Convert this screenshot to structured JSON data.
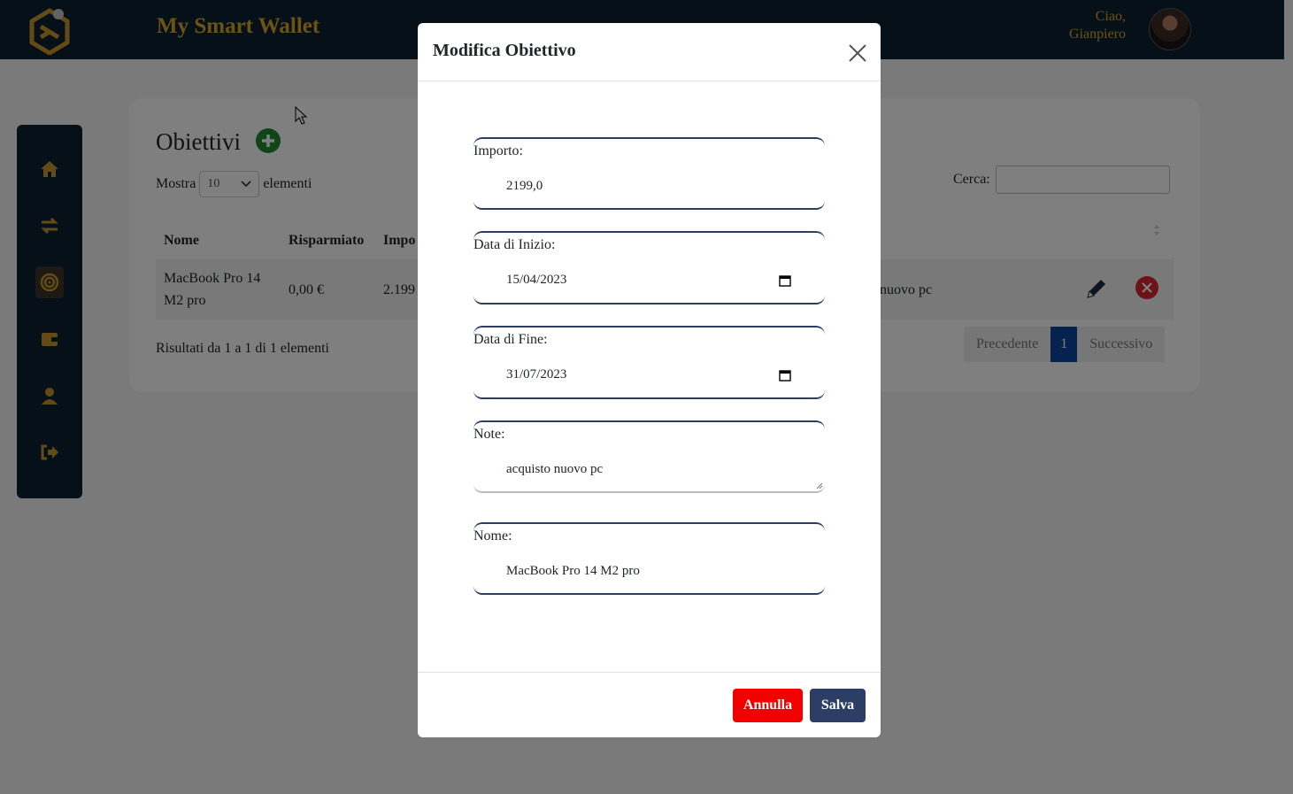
{
  "header": {
    "brand": "My Smart Wallet",
    "greeting_line1": "Ciao,",
    "greeting_line2": "Gianpiero"
  },
  "sidebar": {
    "items": [
      "home-icon",
      "transfer-icon",
      "target-icon",
      "wallet-icon",
      "user-icon",
      "logout-icon"
    ],
    "active": "target-icon"
  },
  "page": {
    "title": "Obiettivi",
    "show_label": "Mostra",
    "show_value": "10",
    "elements_label": "elementi",
    "search_label": "Cerca:",
    "columns": {
      "name": "Nome",
      "saved": "Risparmiato",
      "amount": "Impo"
    },
    "row": {
      "name": "MacBook Pro 14 M2 pro",
      "saved": "0,00 €",
      "amount": "2.199",
      "notes": "nuovo pc"
    },
    "info": "Risultati da 1 a 1 di 1 elementi",
    "pagination": {
      "prev": "Precedente",
      "current": "1",
      "next": "Successivo"
    }
  },
  "modal": {
    "title": "Modifica Obiettivo",
    "fields": {
      "amount": {
        "label": "Importo:",
        "value": "2199,0"
      },
      "start": {
        "label": "Data di Inizio:",
        "value": "15/04/2023"
      },
      "end": {
        "label": "Data di Fine:",
        "value": "31/07/2023"
      },
      "notes": {
        "label": "Note:",
        "value": "acquisto nuovo pc"
      },
      "name": {
        "label": "Nome:",
        "value": "MacBook Pro 14 M2 pro"
      }
    },
    "cancel_label": "Annulla",
    "save_label": "Salva"
  },
  "colors": {
    "navy": "#0d2032",
    "gold": "#d9a62a",
    "danger": "#f20000",
    "primary": "#2c3e66",
    "page_active": "#0d47a1"
  }
}
